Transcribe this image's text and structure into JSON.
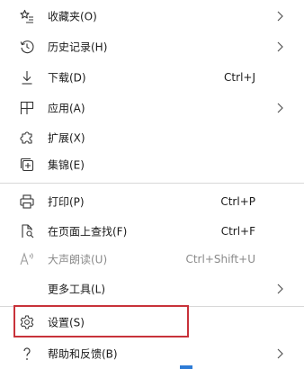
{
  "menu": {
    "items": [
      {
        "icon": "favorites-star-icon",
        "label": "收藏夹(O)",
        "shortcut": "",
        "submenu": true,
        "disabled": false
      },
      {
        "icon": "history-clock-icon",
        "label": "历史记录(H)",
        "shortcut": "",
        "submenu": true,
        "disabled": false
      },
      {
        "icon": "download-arrow-icon",
        "label": "下载(D)",
        "shortcut": "Ctrl+J",
        "submenu": false,
        "disabled": false
      },
      {
        "icon": "apps-grid-icon",
        "label": "应用(A)",
        "shortcut": "",
        "submenu": true,
        "disabled": false
      },
      {
        "icon": "extensions-puzzle-icon",
        "label": "扩展(X)",
        "shortcut": "",
        "submenu": false,
        "disabled": false
      },
      {
        "icon": "collections-icon",
        "label": "集锦(E)",
        "shortcut": "",
        "submenu": false,
        "disabled": false
      },
      {
        "icon": "print-icon",
        "label": "打印(P)",
        "shortcut": "Ctrl+P",
        "submenu": false,
        "disabled": false
      },
      {
        "icon": "find-on-page-icon",
        "label": "在页面上查找(F)",
        "shortcut": "Ctrl+F",
        "submenu": false,
        "disabled": false
      },
      {
        "icon": "read-aloud-icon",
        "label": "大声朗读(U)",
        "shortcut": "Ctrl+Shift+U",
        "submenu": false,
        "disabled": true
      },
      {
        "icon": "",
        "label": "更多工具(L)",
        "shortcut": "",
        "submenu": true,
        "disabled": false
      },
      {
        "icon": "settings-gear-icon",
        "label": "设置(S)",
        "shortcut": "",
        "submenu": false,
        "disabled": false
      },
      {
        "icon": "help-question-icon",
        "label": "帮助和反馈(B)",
        "shortcut": "",
        "submenu": true,
        "disabled": false
      }
    ]
  },
  "colors": {
    "highlight_border": "#c8323a",
    "disabled_text": "#8a8a8a",
    "divider": "#d8d8d8"
  }
}
